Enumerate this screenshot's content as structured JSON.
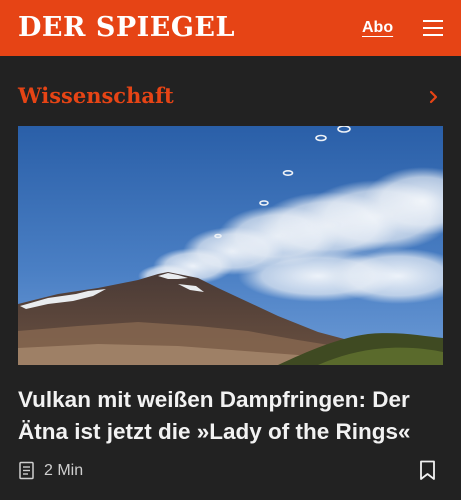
{
  "header": {
    "logo": "DER SPIEGEL",
    "subscribe_label": "Abo",
    "menu_icon": "hamburger-menu-icon",
    "background_color": "#e64415"
  },
  "section": {
    "title": "Wissenschaft",
    "more_icon": "chevron-right-icon",
    "color": "#e64415"
  },
  "article": {
    "image_subject": "volcano-with-steam-rings",
    "headline": "Vulkan mit weißen Dampfringen: Der Ätna ist jetzt die »Lady of the Rings«",
    "reading_time": "2 Min",
    "type_icon": "article-document-icon",
    "bookmark_icon": "bookmark-icon"
  },
  "colors": {
    "background": "#222222",
    "text": "#f2f2f2"
  }
}
